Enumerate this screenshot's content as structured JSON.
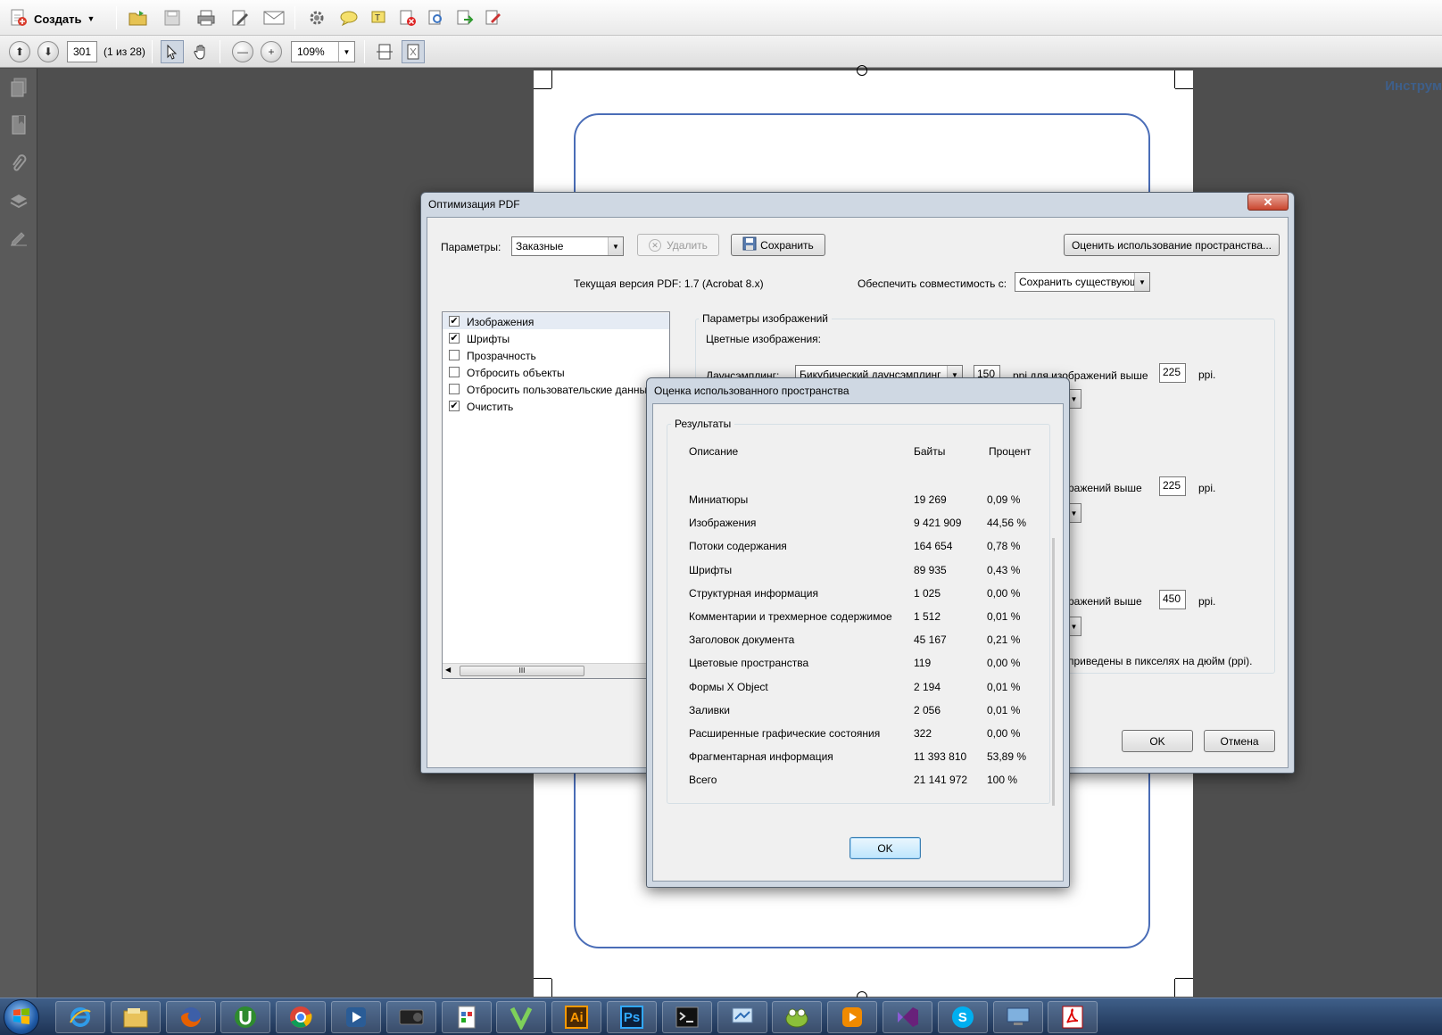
{
  "toolbar": {
    "create_label": "Создать",
    "page_number": "301",
    "page_count": "(1 из 28)",
    "zoom": "109%",
    "tools_label": "Инструм"
  },
  "optimize_dialog": {
    "title": "Оптимизация PDF",
    "params_label": "Параметры:",
    "params_value": "Заказные",
    "delete_button": "Удалить",
    "save_button": "Сохранить",
    "audit_button": "Оценить использование пространства...",
    "current_version": "Текущая версия PDF: 1.7 (Acrobat 8.x)",
    "compat_label": "Обеспечить совместимость с:",
    "compat_value": "Сохранить существующую",
    "categories": [
      {
        "label": "Изображения",
        "checked": true
      },
      {
        "label": "Шрифты",
        "checked": true
      },
      {
        "label": "Прозрачность",
        "checked": false
      },
      {
        "label": "Отбросить объекты",
        "checked": false
      },
      {
        "label": "Отбросить пользовательские данные",
        "checked": false
      },
      {
        "label": "Очистить",
        "checked": true
      }
    ],
    "scroll_grip": "III",
    "image_params_title": "Параметры изображений",
    "color_images_label": "Цветные изображения:",
    "downsampling_label": "Даунсэмплинг:",
    "downsampling_value": "Бикубический даунсэмплинг",
    "downsample_ppi": "150",
    "above_label_1": "ppi для изображений выше",
    "above_label_2": "ражений выше",
    "above_label_3": "ражений выше",
    "ppi_1": "225",
    "ppi_2": "225",
    "ppi_3": "450",
    "ppi_unit": "ppi.",
    "note": "приведены в пикселях на дюйм (ppi).",
    "ok_button": "OK",
    "cancel_button": "Отмена"
  },
  "space_dialog": {
    "title": "Оценка использованного пространства",
    "group_title": "Результаты",
    "headers": {
      "description": "Описание",
      "bytes": "Байты",
      "percent": "Процент"
    },
    "rows": [
      {
        "description": "Миниатюры",
        "bytes": "19 269",
        "percent": "0,09 %"
      },
      {
        "description": "Изображения",
        "bytes": "9 421 909",
        "percent": "44,56 %"
      },
      {
        "description": "Потоки содержания",
        "bytes": "164 654",
        "percent": "0,78 %"
      },
      {
        "description": "Шрифты",
        "bytes": "89 935",
        "percent": "0,43 %"
      },
      {
        "description": "Структурная информация",
        "bytes": "1 025",
        "percent": "0,00 %"
      },
      {
        "description": "Комментарии и трехмерное содержимое",
        "bytes": "1 512",
        "percent": "0,01 %"
      },
      {
        "description": "Заголовок документа",
        "bytes": "45 167",
        "percent": "0,21 %"
      },
      {
        "description": "Цветовые пространства",
        "bytes": "119",
        "percent": "0,00 %"
      },
      {
        "description": "Формы X Object",
        "bytes": "2 194",
        "percent": "0,01 %"
      },
      {
        "description": "Заливки",
        "bytes": "2 056",
        "percent": "0,01 %"
      },
      {
        "description": "Расширенные графические состояния",
        "bytes": "322",
        "percent": "0,00 %"
      },
      {
        "description": "Фрагментарная информация",
        "bytes": "11 393 810",
        "percent": "53,89 %"
      },
      {
        "description": "Всего",
        "bytes": "21 141 972",
        "percent": "100 %"
      }
    ],
    "ok_button": "OK"
  },
  "taskbar": {
    "apps": [
      "internet-explorer",
      "file-explorer",
      "firefox",
      "utorrent",
      "chrome",
      "media-player",
      "gopro",
      "document",
      "vegas",
      "illustrator",
      "photoshop",
      "terminal",
      "network",
      "frog-app",
      "vlc",
      "visual-studio",
      "skype",
      "remote-desktop",
      "acrobat"
    ],
    "ai_label": "Ai",
    "ps_label": "Ps",
    "skype_label": "S"
  },
  "colors": {
    "accent_blue": "#4a6db7",
    "workspace": "#4e4e4e",
    "taskbar": "#1d3253"
  }
}
